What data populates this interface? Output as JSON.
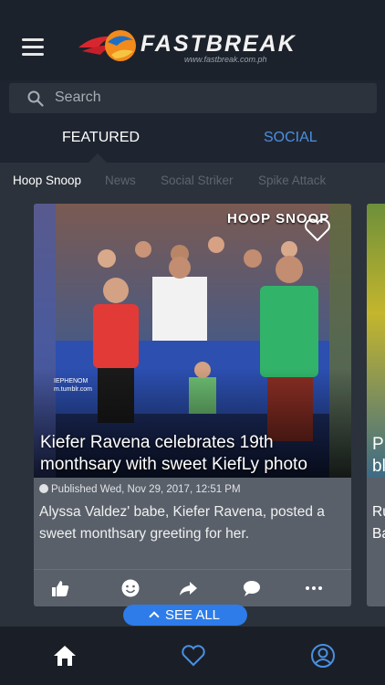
{
  "header": {
    "brand": "FASTBREAK",
    "brand_url": "www.fastbreak.com.ph"
  },
  "search": {
    "placeholder": "Search"
  },
  "tabs": [
    {
      "label": "FEATURED",
      "active": true
    },
    {
      "label": "SOCIAL",
      "active": false
    }
  ],
  "subtabs": [
    {
      "label": "Hoop Snoop",
      "active": true
    },
    {
      "label": "News",
      "active": false
    },
    {
      "label": "Social Striker",
      "active": false
    },
    {
      "label": "Spike Attack",
      "active": false
    }
  ],
  "card": {
    "badge": "HOOP SNOOP",
    "headline": "Kiefer Ravena celebrates 19th monthsary with sweet KiefLy photo",
    "published": "Published Wed, Nov 29, 2017, 12:51 PM",
    "description": "Alyssa Valdez' babe, Kiefer Ravena, posted a sweet monthsary greeting for her.",
    "image_text": "IEPHENOM\nm.tumblr.com",
    "actions": [
      "like-icon",
      "smiley-icon",
      "share-icon",
      "comment-icon",
      "more-icon"
    ]
  },
  "card2": {
    "headline_partial": "P\nbl",
    "desc_partial": "Ru\nBa"
  },
  "see_all": {
    "label": "SEE ALL"
  },
  "bottom_nav": [
    "home-icon",
    "heart-icon",
    "profile-icon"
  ],
  "colors": {
    "accent": "#2d7ce9",
    "social_tab": "#4a90e2",
    "background": "#1f2530"
  }
}
